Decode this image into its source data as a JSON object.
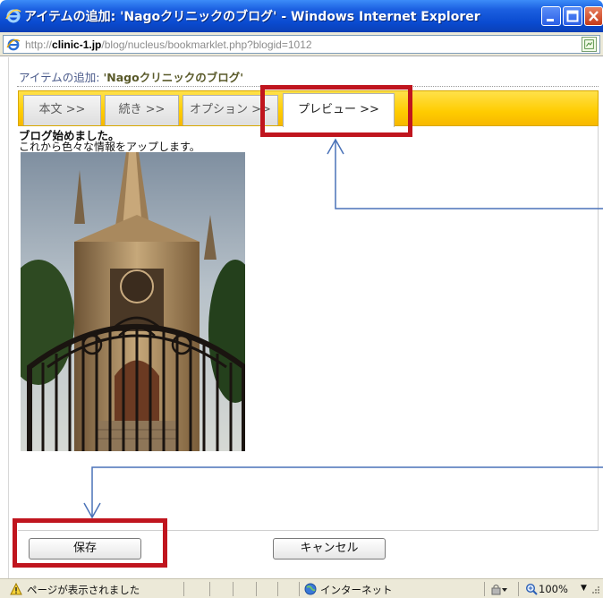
{
  "window": {
    "title": "アイテムの追加: 'Nagoクリニックのブログ' - Windows Internet Explorer"
  },
  "address": {
    "url_prefix": "http://",
    "url_host": "clinic-1.jp",
    "url_path": "/blog/nucleus/bookmarklet.php?blogid=1012"
  },
  "page": {
    "heading_prefix": "アイテムの追加: ",
    "heading_blog": "'Nagoクリニックのブログ'",
    "tabs": [
      {
        "label": "本文 >>"
      },
      {
        "label": "続き >>"
      },
      {
        "label": "オプション >>"
      },
      {
        "label": "プレビュー >>"
      }
    ],
    "preview": {
      "title": "ブログ始めました。",
      "text": "これから色々な情報をアップします。"
    },
    "buttons": {
      "save": "保存",
      "cancel": "キャンセル"
    }
  },
  "status": {
    "message": "ページが表示されました",
    "zone": "インターネット",
    "zoom": "100%"
  },
  "colors": {
    "highlight": "#c0151e",
    "arrow": "#4a72b8",
    "tab_strip": "#ffcc00"
  }
}
